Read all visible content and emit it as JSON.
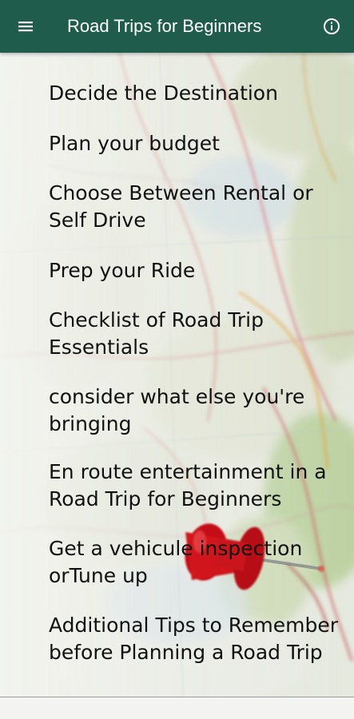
{
  "app_bar": {
    "title": "Road Trips for Beginners",
    "background": "#1f5c4b",
    "menu_icon": "hamburger-menu-icon",
    "info_icon": "info-icon"
  },
  "topics": [
    "Decide the Destination",
    "Plan your budget",
    "Choose Between Rental or Self Drive",
    "Prep your Ride",
    "Checklist of Road Trip Essentials",
    "consider what else you're bringing",
    "En route entertainment in a Road Trip for Beginners",
    "Get a vehicule inspection orTune up",
    "Additional Tips to Remember before Planning a Road Trip"
  ]
}
